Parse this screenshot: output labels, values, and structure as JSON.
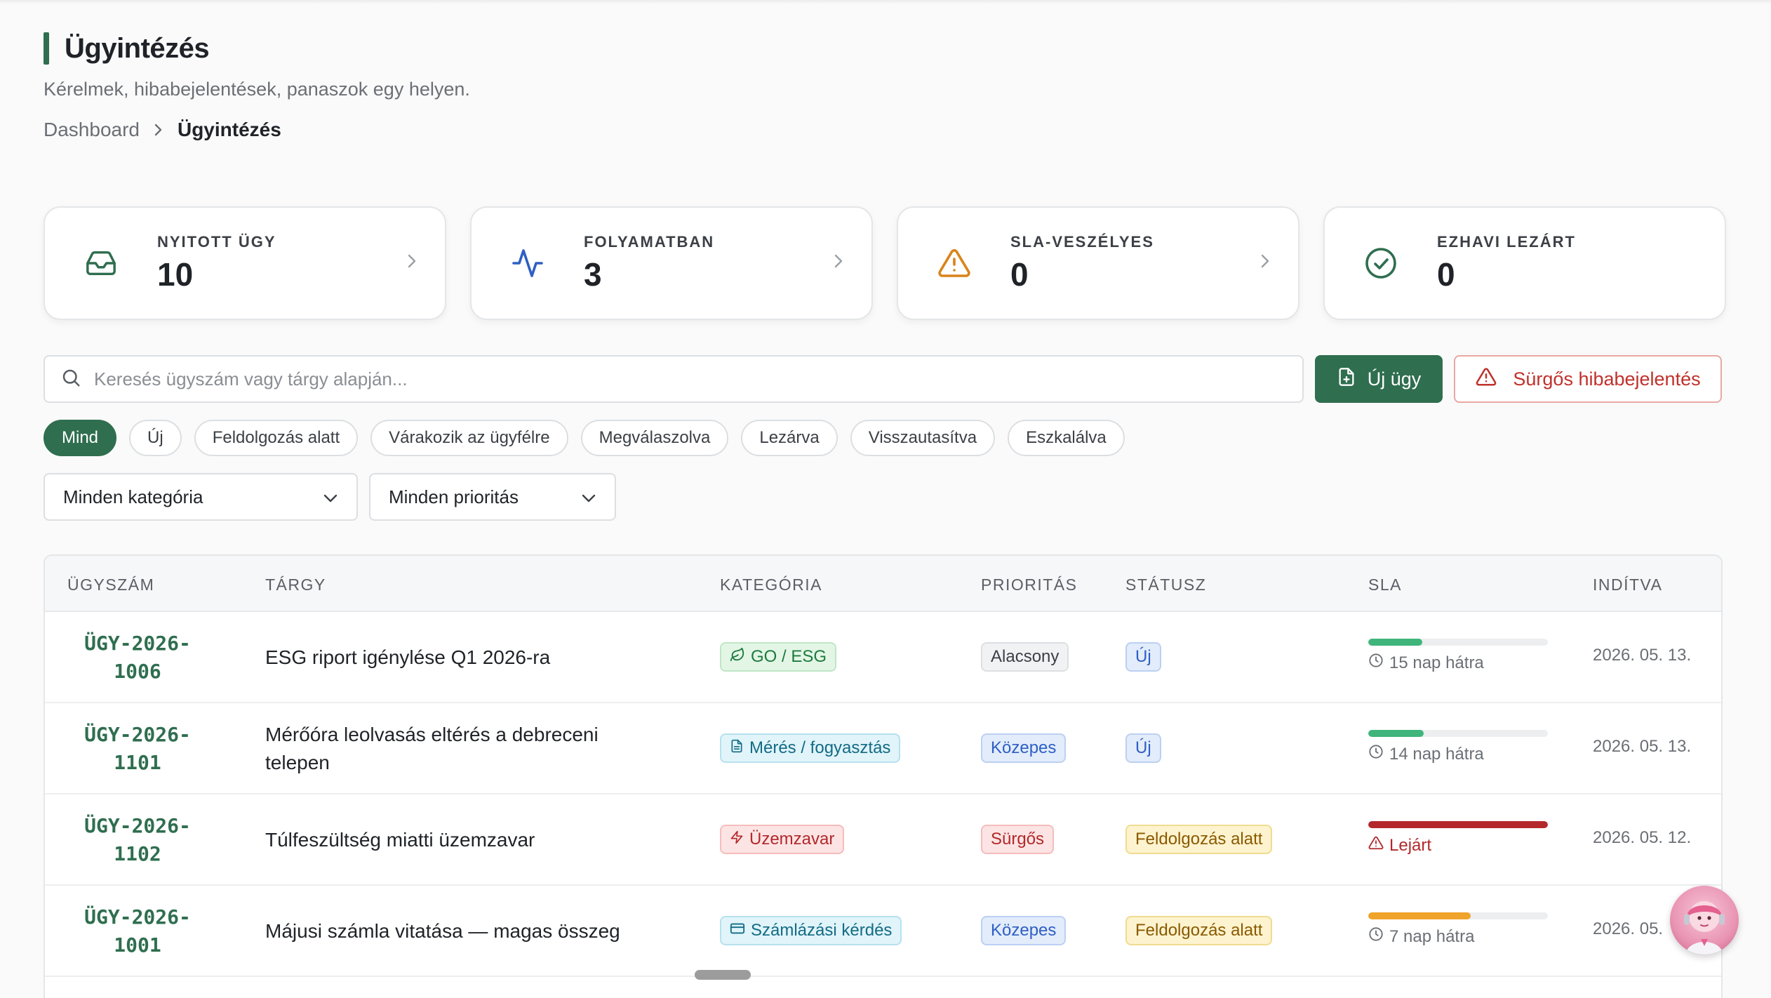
{
  "header": {
    "title": "Ügyintézés",
    "subtitle": "Kérelmek, hibabejelentések, panaszok egy helyen.",
    "breadcrumb": {
      "home": "Dashboard",
      "current": "Ügyintézés"
    }
  },
  "stats": [
    {
      "label": "NYITOTT ÜGY",
      "value": "10",
      "icon": "inbox-icon",
      "color": "#2f6e4f",
      "bg": "#d9efe2"
    },
    {
      "label": "FOLYAMATBAN",
      "value": "3",
      "icon": "activity-icon",
      "color": "#2f5fc4",
      "bg": "#dbe5f7"
    },
    {
      "label": "SLA-VESZÉLYES",
      "value": "0",
      "icon": "alert-triangle-icon",
      "color": "#d9841a",
      "bg": "#fbe6c2"
    },
    {
      "label": "EZHAVI LEZÁRT",
      "value": "0",
      "icon": "check-circle-icon",
      "color": "#2f6e4f",
      "bg": "#cdeadb"
    }
  ],
  "search": {
    "placeholder": "Keresés ügyszám vagy tárgy alapján..."
  },
  "actions": {
    "new_label": "Új ügy",
    "urgent_label": "Sürgős hibabejelentés"
  },
  "status_filters": [
    "Mind",
    "Új",
    "Feldolgozás alatt",
    "Várakozik az ügyfélre",
    "Megválaszolva",
    "Lezárva",
    "Visszautasítva",
    "Eszkalálva"
  ],
  "active_filter": "Mind",
  "selects": {
    "category": "Minden kategória",
    "priority": "Minden prioritás"
  },
  "table": {
    "columns": [
      "ÜGYSZÁM",
      "TÁRGY",
      "KATEGÓRIA",
      "PRIORITÁS",
      "STÁTUSZ",
      "SLA",
      "INDÍTVA"
    ],
    "rows": [
      {
        "id_line1": "ÜGY-2026-",
        "id_line2": "1006",
        "subject_line1": "ESG riport igénylése Q1 2026-ra",
        "subject_line2": "",
        "category": "GO / ESG",
        "category_icon": "leaf-icon",
        "priority": "Alacsony",
        "status": "Új",
        "sla_progress": 0.3,
        "sla_text": "15 nap hátra",
        "sla_color": "#3fb57b",
        "sla_icon": "clock-icon",
        "date": "2026. 05. 13."
      },
      {
        "id_line1": "ÜGY-2026-",
        "id_line2": "1101",
        "subject_line1": "Mérőóra leolvasás eltérés a debreceni",
        "subject_line2": "telepen",
        "category": "Mérés / fogyasztás",
        "category_icon": "document-icon",
        "priority": "Közepes",
        "status": "Új",
        "sla_progress": 0.31,
        "sla_text": "14 nap hátra",
        "sla_color": "#3fb57b",
        "sla_icon": "clock-icon",
        "date": "2026. 05. 13."
      },
      {
        "id_line1": "ÜGY-2026-",
        "id_line2": "1102",
        "subject_line1": "Túlfeszültség miatti üzemzavar",
        "subject_line2": "",
        "category": "Üzemzavar",
        "category_icon": "lightning-icon",
        "priority": "Sürgős",
        "status": "Feldolgozás alatt",
        "sla_progress": 1.0,
        "sla_text": "Lejárt",
        "sla_color": "#b3282b",
        "sla_icon": "alert-triangle-icon",
        "date": "2026. 05. 12."
      },
      {
        "id_line1": "ÜGY-2026-",
        "id_line2": "1001",
        "subject_line1": "Májusi számla vitatása — magas összeg",
        "subject_line2": "",
        "category": "Számlázási kérdés",
        "category_icon": "credit-card-icon",
        "priority": "Közepes",
        "status": "Feldolgozás alatt",
        "sla_progress": 0.57,
        "sla_text": "7 nap hátra",
        "sla_color": "#f0a32a",
        "sla_icon": "clock-icon",
        "date": "2026. 05."
      }
    ]
  }
}
